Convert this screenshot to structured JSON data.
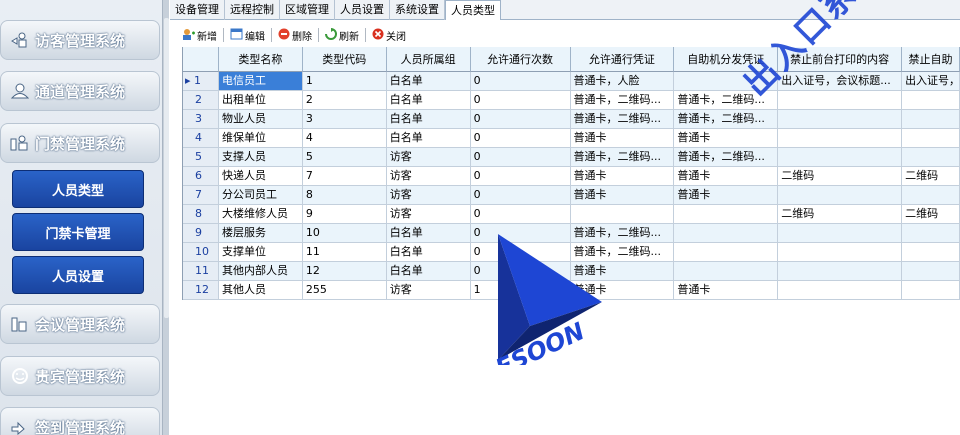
{
  "sidebar": {
    "items": [
      {
        "label": "访客管理系统",
        "icon": "visitor-icon"
      },
      {
        "label": "通道管理系统",
        "icon": "user-icon"
      },
      {
        "label": "门禁管理系统",
        "icon": "door-icon"
      },
      {
        "label": "会议管理系统",
        "icon": "meeting-icon"
      },
      {
        "label": "贵宾管理系统",
        "icon": "vip-icon"
      },
      {
        "label": "签到管理系统",
        "icon": "checkin-icon"
      }
    ],
    "sub_items": [
      {
        "label": "人员类型"
      },
      {
        "label": "门禁卡管理"
      },
      {
        "label": "人员设置"
      }
    ]
  },
  "tabs": [
    {
      "label": "设备管理"
    },
    {
      "label": "远程控制"
    },
    {
      "label": "区域管理"
    },
    {
      "label": "人员设置"
    },
    {
      "label": "系统设置"
    },
    {
      "label": "人员类型"
    }
  ],
  "toolbar": {
    "new_label": "新增",
    "edit_label": "编辑",
    "delete_label": "删除",
    "refresh_label": "刷新",
    "close_label": "关闭"
  },
  "grid": {
    "headers": [
      "类型名称",
      "类型代码",
      "人员所属组",
      "允许通行次数",
      "允许通行凭证",
      "自助机分发凭证",
      "禁止前台打印的内容",
      "禁止自助"
    ],
    "rows": [
      {
        "idx": "1",
        "name": "电信员工",
        "code": "1",
        "group": "白名单",
        "count": "0",
        "cred": "普通卡，人脸",
        "self": "",
        "noprint": "出入证号，会议标题...",
        "noself": "出入证号，"
      },
      {
        "idx": "2",
        "name": "出租单位",
        "code": "2",
        "group": "白名单",
        "count": "0",
        "cred": "普通卡，二维码...",
        "self": "普通卡，二维码...",
        "noprint": "",
        "noself": ""
      },
      {
        "idx": "3",
        "name": "物业人员",
        "code": "3",
        "group": "白名单",
        "count": "0",
        "cred": "普通卡，二维码...",
        "self": "普通卡，二维码...",
        "noprint": "",
        "noself": ""
      },
      {
        "idx": "4",
        "name": "维保单位",
        "code": "4",
        "group": "白名单",
        "count": "0",
        "cred": "普通卡",
        "self": "普通卡",
        "noprint": "",
        "noself": ""
      },
      {
        "idx": "5",
        "name": "支撑人员",
        "code": "5",
        "group": "访客",
        "count": "0",
        "cred": "普通卡，二维码...",
        "self": "普通卡，二维码...",
        "noprint": "",
        "noself": ""
      },
      {
        "idx": "6",
        "name": "快递人员",
        "code": "7",
        "group": "访客",
        "count": "0",
        "cred": "普通卡",
        "self": "普通卡",
        "noprint": "二维码",
        "noself": "二维码"
      },
      {
        "idx": "7",
        "name": "分公司员工",
        "code": "8",
        "group": "访客",
        "count": "0",
        "cred": "普通卡",
        "self": "普通卡",
        "noprint": "",
        "noself": ""
      },
      {
        "idx": "8",
        "name": "大楼维修人员",
        "code": "9",
        "group": "访客",
        "count": "0",
        "cred": "",
        "self": "",
        "noprint": "二维码",
        "noself": "二维码"
      },
      {
        "idx": "9",
        "name": "楼层服务",
        "code": "10",
        "group": "白名单",
        "count": "0",
        "cred": "普通卡，二维码...",
        "self": "",
        "noprint": "",
        "noself": ""
      },
      {
        "idx": "10",
        "name": "支撑单位",
        "code": "11",
        "group": "白名单",
        "count": "0",
        "cred": "普通卡，二维码...",
        "self": "",
        "noprint": "",
        "noself": ""
      },
      {
        "idx": "11",
        "name": "其他内部人员",
        "code": "12",
        "group": "白名单",
        "count": "0",
        "cred": "普通卡",
        "self": "",
        "noprint": "",
        "noself": ""
      },
      {
        "idx": "12",
        "name": "其他人员",
        "code": "255",
        "group": "访客",
        "count": "1",
        "cred": "普通卡",
        "self": "普通卡",
        "noprint": "",
        "noself": ""
      }
    ]
  },
  "watermark": {
    "text": "出入口系统",
    "logo_text": "ESOON",
    "color": "#1e46d4"
  }
}
